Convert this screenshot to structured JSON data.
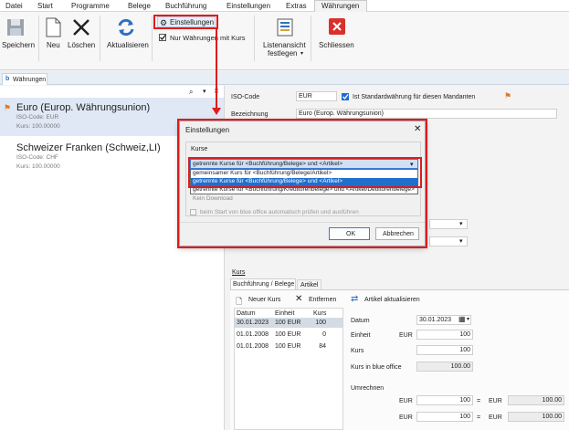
{
  "menu": [
    "Datei",
    "Start",
    "Programme",
    "Belege",
    "Buchführung",
    "Einstellungen",
    "Extras",
    "Währungen"
  ],
  "ribbon": {
    "speichern": "Speichern",
    "neu": "Neu",
    "loeschen": "Löschen",
    "aktualisieren": "Aktualisieren",
    "einstellungen": "Einstellungen",
    "nur_waehrungen": "Nur Währungen mit Kurs",
    "listenansicht_1": "Listenansicht",
    "listenansicht_2": "festlegen",
    "schliessen": "Schliessen"
  },
  "doc_tab": "Währungen",
  "currencies": [
    {
      "name": "Euro (Europ. Währungsunion)",
      "iso": "ISO-Code: EUR",
      "kurs": "Kurs: 100.00000"
    },
    {
      "name": "Schweizer Franken (Schweiz,LI)",
      "iso": "ISO-Code: CHF",
      "kurs": "Kurs: 100.00000"
    }
  ],
  "form": {
    "iso_label": "ISO-Code",
    "iso_value": "EUR",
    "standard_label": "Ist Standardwährung für diesen Mandanten",
    "bez_label": "Bezeichnung",
    "bez_value": "Euro (Europ. Währungsunion)"
  },
  "kurs_section": {
    "title": "Kurs",
    "tab1": "Buchführung / Belege",
    "tab2": "Artikel",
    "new_kurs": "Neuer Kurs",
    "entfernen": "Entfernen",
    "artikel_aktualisieren": "Artikel aktualisieren",
    "headers": [
      "Datum",
      "Einheit",
      "Kurs"
    ],
    "rows": [
      {
        "datum": "30.01.2023",
        "einheit": "100 EUR",
        "kurs": "100"
      },
      {
        "datum": "01.01.2008",
        "einheit": "100 EUR",
        "kurs": "0"
      },
      {
        "datum": "01.01.2008",
        "einheit": "100 EUR",
        "kurs": "84"
      }
    ],
    "datum_label": "Datum",
    "datum_value": "30.01.2023",
    "einheit_label": "Einheit",
    "einheit_cur": "EUR",
    "einheit_value": "100",
    "kurs_label": "Kurs",
    "kurs_value": "100",
    "blue_label": "Kurs in blue office",
    "blue_value": "100.00",
    "umrechnen": "Umrechnen",
    "conv": [
      {
        "cur1": "EUR",
        "val1": "100",
        "eq": "=",
        "cur2": "EUR",
        "val2": "100.00"
      },
      {
        "cur1": "EUR",
        "val1": "100",
        "eq": "=",
        "cur2": "EUR",
        "val2": "100.00"
      }
    ]
  },
  "dialog": {
    "title": "Einstellungen",
    "group": "Kurse",
    "selected": "getrennte Kurse für <Buchführung/Belege> und <Artikel>",
    "options": [
      "gemeinsamer Kurs für <Buchführung/Belege/Artikel>",
      "getrennte Kurse für <Buchführung/Belege> und <Artikel>",
      "getrennte Kurse für <Buchführung/Kreditorenbelege> und <Artikel/Debitorenbelege>"
    ],
    "kein_download": "Kein Download",
    "auto_check": "beim Start von blue office automatisch prüfen und ausführen",
    "ok": "OK",
    "abbrechen": "Abbrechen"
  },
  "colors": {
    "accent": "#e01b1b",
    "selection": "#1f6fcf",
    "list_select": "#dfe8f4"
  }
}
